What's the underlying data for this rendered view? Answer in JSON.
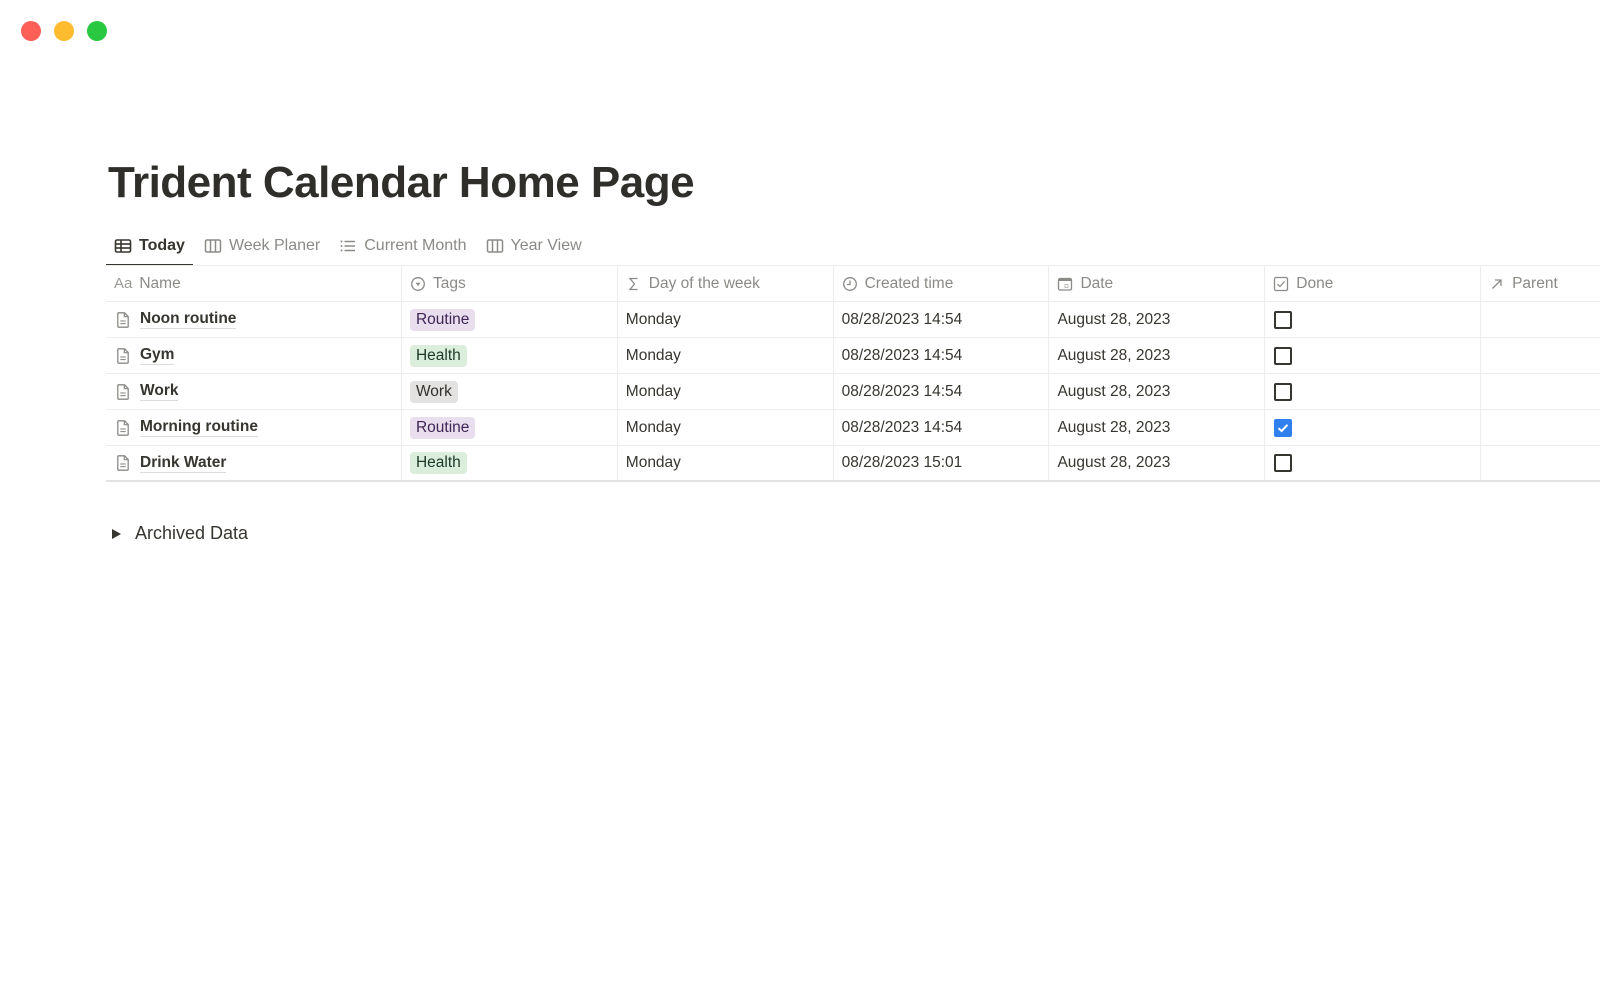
{
  "window": {
    "controls": [
      "close",
      "minimize",
      "maximize"
    ]
  },
  "page": {
    "title": "Trident Calendar Home Page"
  },
  "tabs": [
    {
      "label": "Today",
      "icon": "table-icon",
      "active": true
    },
    {
      "label": "Week Planer",
      "icon": "board-icon",
      "active": false
    },
    {
      "label": "Current Month",
      "icon": "list-icon",
      "active": false
    },
    {
      "label": "Year View",
      "icon": "board-icon",
      "active": false
    }
  ],
  "table": {
    "columns": [
      {
        "label": "Name",
        "icon": "text-aa-icon"
      },
      {
        "label": "Tags",
        "icon": "select-icon"
      },
      {
        "label": "Day of the week",
        "icon": "formula-sigma-icon"
      },
      {
        "label": "Created time",
        "icon": "clock-icon"
      },
      {
        "label": "Date",
        "icon": "calendar-icon"
      },
      {
        "label": "Done",
        "icon": "checkbox-icon"
      },
      {
        "label": "Parent",
        "icon": "relation-arrow-icon"
      }
    ],
    "name_prefix": "Aa",
    "rows": [
      {
        "name": "Noon routine",
        "tag": "Routine",
        "day": "Monday",
        "created": "08/28/2023 14:54",
        "date": "August 28, 2023",
        "done": false
      },
      {
        "name": "Gym",
        "tag": "Health",
        "day": "Monday",
        "created": "08/28/2023 14:54",
        "date": "August 28, 2023",
        "done": false
      },
      {
        "name": "Work",
        "tag": "Work",
        "day": "Monday",
        "created": "08/28/2023 14:54",
        "date": "August 28, 2023",
        "done": false
      },
      {
        "name": "Morning routine",
        "tag": "Routine",
        "day": "Monday",
        "created": "08/28/2023 14:54",
        "date": "August 28, 2023",
        "done": true
      },
      {
        "name": "Drink Water",
        "tag": "Health",
        "day": "Monday",
        "created": "08/28/2023 15:01",
        "date": "August 28, 2023",
        "done": false
      }
    ],
    "tag_colors": {
      "Routine": {
        "bg": "#e8deee",
        "fg": "#412454"
      },
      "Health": {
        "bg": "#dbeddb",
        "fg": "#1c3829"
      },
      "Work": {
        "bg": "#e3e2e0",
        "fg": "#32302c"
      }
    },
    "checkbox_accent": "#2f80ed"
  },
  "archived": {
    "label": "Archived Data"
  }
}
